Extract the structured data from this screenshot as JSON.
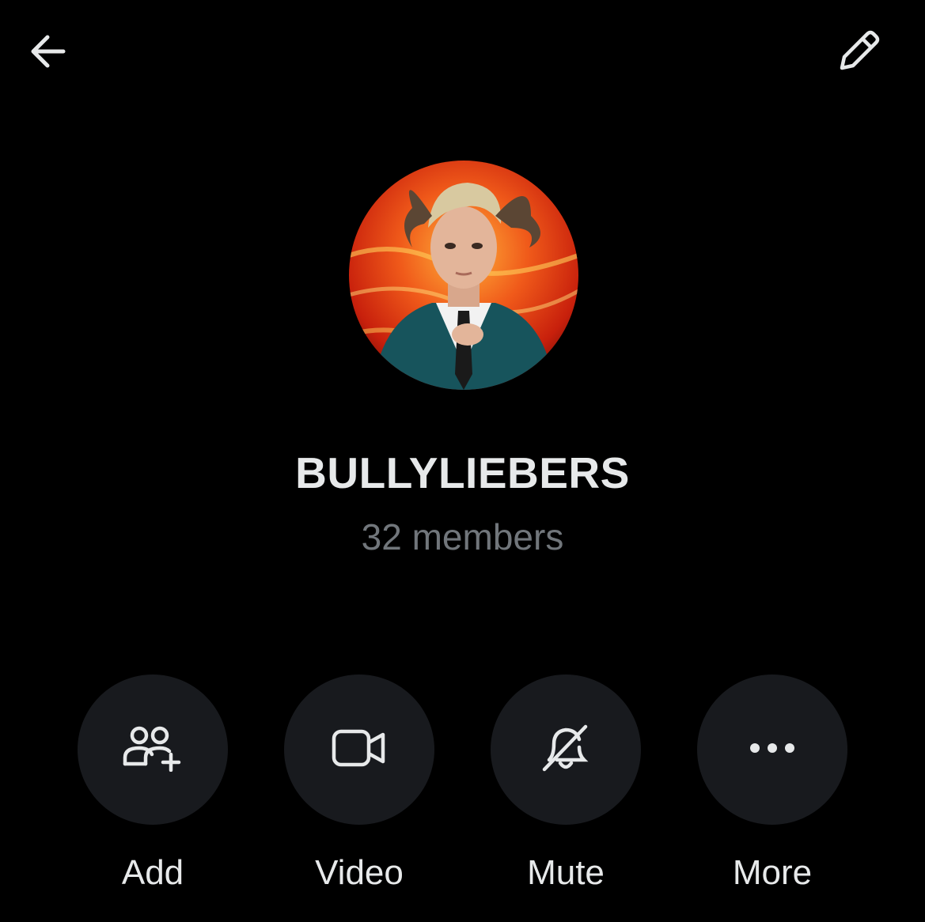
{
  "header": {
    "back_icon": "arrow-left-icon",
    "edit_icon": "pencil-icon"
  },
  "group": {
    "name": "BULLYLIEBERS",
    "members": "32 members",
    "avatar": "group-avatar-photo"
  },
  "actions": [
    {
      "label": "Add",
      "icon": "add-people-icon"
    },
    {
      "label": "Video",
      "icon": "video-camera-icon"
    },
    {
      "label": "Mute",
      "icon": "bell-off-icon"
    },
    {
      "label": "More",
      "icon": "more-dots-icon"
    }
  ],
  "colors": {
    "background": "#000000",
    "button_bg": "#181a1e",
    "text": "#e7e9ea",
    "muted_text": "#71767b"
  }
}
